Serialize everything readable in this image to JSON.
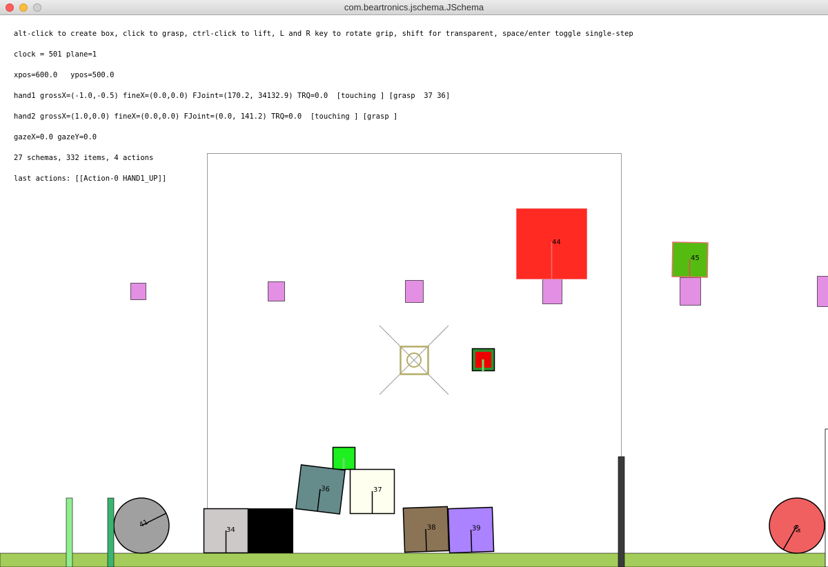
{
  "window": {
    "title": "com.beartronics.jschema.JSchema"
  },
  "status": {
    "line1": "alt-click to create box, click to grasp, ctrl-click to lift, L and R key to rotate grip, shift for transparent, space/enter toggle single-step",
    "line2": "clock = 501 plane=1",
    "line3": "xpos=600.0   ypos=500.0",
    "line4": "hand1 grossX=(-1.0,-0.5) fineX=(0.0,0.0) FJoint=(170.2, 34132.9) TRQ=0.0  [touching ] [grasp  37 36]",
    "line5": "hand2 grossX=(1.0,0.0) fineX=(0.0,0.0) FJoint=(0.0, 141.2) TRQ=0.0  [touching ] [grasp ]",
    "line6": "gazeX=0.0 gazeY=0.0",
    "line7": "27 schemas, 332 items, 4 actions",
    "line8": "last actions: [[Action-0 HAND1_UP]]"
  },
  "objects": {
    "box34": {
      "label": "34",
      "color": "#cdc9c9"
    },
    "box36": {
      "label": "36",
      "color": "#668b8b"
    },
    "box37": {
      "label": "37",
      "color": "#fffff0"
    },
    "box38": {
      "label": "38",
      "color": "#8b7355"
    },
    "box39": {
      "label": "39",
      "color": "#ab82ff"
    },
    "ball40": {
      "label": "40",
      "color": "#f06060"
    },
    "ball41": {
      "label": "41",
      "color": "#a0a0a0"
    },
    "box44": {
      "label": "44",
      "color": "#ff2a22"
    },
    "box45": {
      "label": "45",
      "color": "#55bb11"
    }
  },
  "colors": {
    "ground": "#a4cc5a",
    "pink": "#e38fe3",
    "green_block": "#1eef1e",
    "hand_red": "#ee0000",
    "gaze": "#b4ac66"
  }
}
